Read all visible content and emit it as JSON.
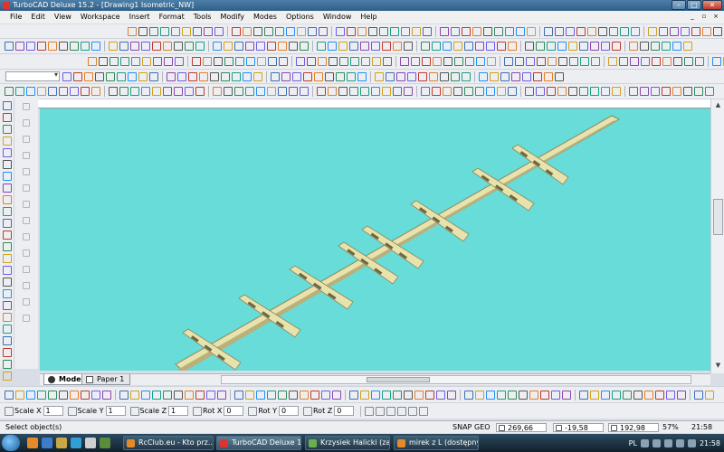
{
  "window": {
    "title": "TurboCAD Deluxe 15.2 - [Drawing1 Isometric_NW]",
    "controls": {
      "minimize": "–",
      "maximize": "□",
      "close": "✕"
    }
  },
  "menubar": {
    "items": [
      "File",
      "Edit",
      "View",
      "Workspace",
      "Insert",
      "Format",
      "Tools",
      "Modify",
      "Modes",
      "Options",
      "Window",
      "Help"
    ],
    "mdi_controls": [
      "_",
      "▫",
      "×"
    ]
  },
  "view_tabs": [
    {
      "label": "Model",
      "active": true
    },
    {
      "label": "Paper 1",
      "active": false
    }
  ],
  "inspector": {
    "fields": [
      {
        "label": "Scale X",
        "value": "1"
      },
      {
        "label": "Scale Y",
        "value": "1"
      },
      {
        "label": "Scale Z",
        "value": "1"
      },
      {
        "label": "Rot X",
        "value": "0"
      },
      {
        "label": "Rot Y",
        "value": "0"
      },
      {
        "label": "Rot Z",
        "value": "0"
      }
    ]
  },
  "status": {
    "message": "Select object(s)",
    "snap": "SNAP",
    "geo": "GEO",
    "x": "269,66 mm",
    "y": "-19,58 mm",
    "z": "192,98 mm",
    "zoom": "57%",
    "time": "21:58"
  },
  "taskbar": {
    "tasks": [
      {
        "label": "RcClub.eu - Kto prz...",
        "active": false
      },
      {
        "label": "TurboCAD Deluxe 1...",
        "active": true
      },
      {
        "label": "Krzysiek Halicki (zar...",
        "active": false
      },
      {
        "label": "mirek z L (dostępny)",
        "active": false
      }
    ],
    "language": "PL",
    "clock": "21:58"
  },
  "colors": {
    "viewport_bg": "#68dcd8",
    "model_fill": "#e8e2ad",
    "model_dark": "#8f875a"
  }
}
